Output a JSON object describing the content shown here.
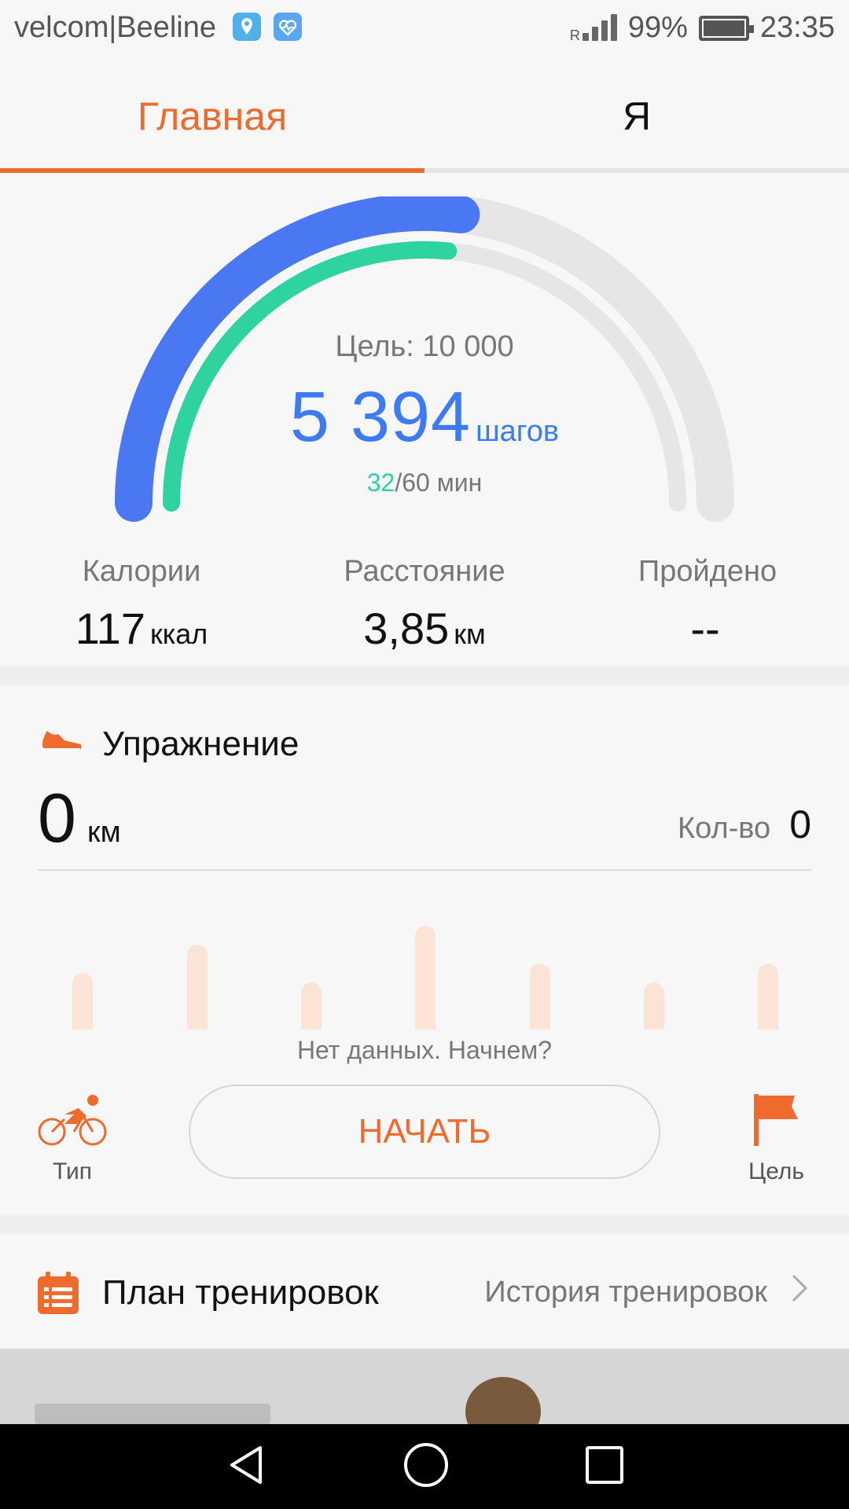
{
  "status_bar": {
    "carrier": "velcom|Beeline",
    "roaming": "R",
    "battery_percent": "99%",
    "time": "23:35"
  },
  "tabs": [
    {
      "label": "Главная",
      "active": true
    },
    {
      "label": "Я",
      "active": false
    }
  ],
  "steps": {
    "goal_text": "Цель: 10 000",
    "count": "5 394",
    "unit": "шагов",
    "minutes_done": "32",
    "minutes_rest": "/60 мин",
    "steps_progress": 0.54,
    "minutes_progress": 0.53
  },
  "stats": [
    {
      "label": "Калории",
      "value": "117",
      "unit": "ккал"
    },
    {
      "label": "Расстояние",
      "value": "3,85",
      "unit": "км"
    },
    {
      "label": "Пройдено",
      "value": "--",
      "unit": ""
    }
  ],
  "exercise": {
    "title": "Упражнение",
    "distance": "0",
    "distance_unit": "км",
    "count_label": "Кол-во",
    "count_value": "0",
    "no_data": "Нет данных. Начнем?",
    "type_label": "Тип",
    "start_label": "НАЧАТЬ",
    "goal_label": "Цель"
  },
  "plan": {
    "title": "План тренировок",
    "history": "История тренировок"
  },
  "colors": {
    "accent": "#ee6a2d",
    "steps_blue": "#3d7bf5",
    "minutes_green": "#2ed39f"
  }
}
